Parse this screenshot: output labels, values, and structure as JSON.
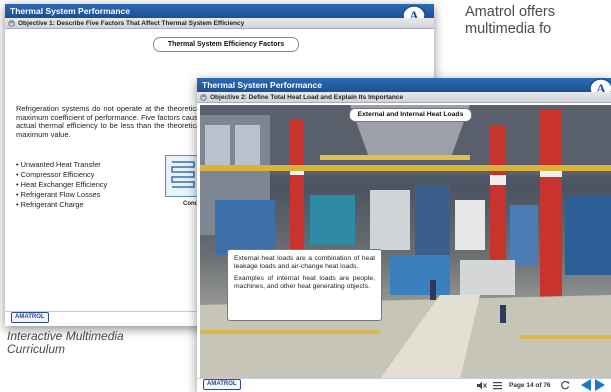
{
  "marketing": {
    "headline": "Amatrol offers multimedia fo",
    "curriculum": "Interactive Multimedia Curriculum"
  },
  "back_window": {
    "title": "Thermal System Performance",
    "objective": "Objective 1: Describe Five Factors That Affect Thermal System Efficiency",
    "section_title": "Thermal System Efficiency Factors",
    "body": "Refrigeration systems do not operate at the theoretical maximum coefficient of performance. Five factors cause actual thermal efficiency to be less than the theoretical maximum value.",
    "factors": [
      "Unwanted Heat Transfer",
      "Compressor Efficiency",
      "Heat Exchanger Efficiency",
      "Refrigerant Flow Losses",
      "Refrigerant Charge"
    ],
    "diagram_label": "Cond",
    "footer_logo": "AMATROL"
  },
  "front_window": {
    "title": "Thermal System Performance",
    "objective": "Objective 2: Define Total Heat Load and Explain Its Importance",
    "photo_caption": "External and Internal Heat Loads",
    "info_paragraph_1": "External heat loads are a combination of heat leakage loads and air-change heat loads.",
    "info_paragraph_2": "Examples of internal heat loads are people, machines, and other heat generating objects.",
    "footer_logo": "AMATROL",
    "page_indicator": "Page 14 of 76",
    "icons": [
      "mute-icon",
      "menu-icon",
      "refresh-icon",
      "prev-arrow-icon",
      "next-arrow-icon"
    ]
  },
  "colors": {
    "title_bar": "#1f58a3",
    "nav_arrow": "#1a78c9",
    "marketing_text": "#4a4a4a"
  }
}
